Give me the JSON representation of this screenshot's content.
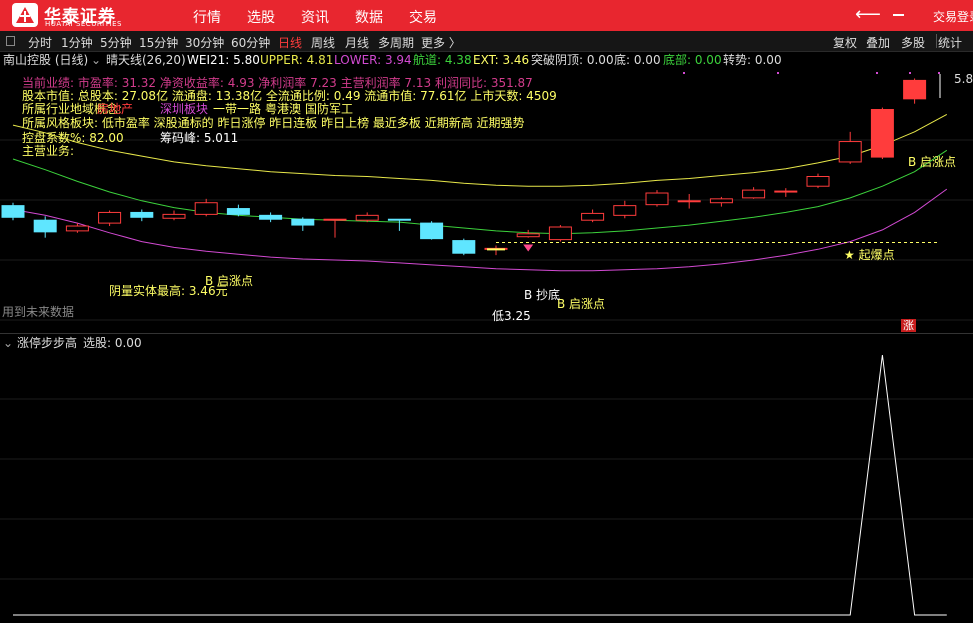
{
  "header": {
    "brand": "华泰证券",
    "brand_en": "HUATAI SECURITIES",
    "nav": [
      "行情",
      "选股",
      "资讯",
      "数据",
      "交易"
    ],
    "back_icon": "arrow-left-icon",
    "trade_login": "交易登录",
    "accent_color": "#e8262f"
  },
  "toolbar": {
    "periods": [
      "分时",
      "1分钟",
      "5分钟",
      "15分钟",
      "30分钟",
      "60分钟",
      "日线",
      "周线",
      "月线",
      "多周期",
      "更多 〉"
    ],
    "active_period": "日线",
    "tools": [
      "复权",
      "叠加",
      "多股",
      "统计"
    ]
  },
  "stock": {
    "title": "南山控股 (日线)",
    "indicator_name": "晴天线(26,20)",
    "wei21": "WEI21: 5.80",
    "upper": "UPPER: 4.81",
    "lower": "LOWER: 3.94",
    "channel": "航道: 4.38",
    "ext": "EXT: 3.46",
    "breakout": "突破阴顶: 0.00",
    "bottom": "底: 0.00",
    "bottom_part": "底部: 0.00",
    "turn": "转势: 0.00"
  },
  "info": {
    "line1": "当前业绩: 市盈率: 31.32 净资收益率: 4.93 净利润率 7.23 主营利润率 7.13 利润同比: 351.87",
    "line2": "股本市值: 总股本: 27.08亿 流通盘: 13.38亿 全流通比例: 0.49 流通市值: 77.61亿 上市天数: 4509",
    "line3_label": "所属行业地域概念:",
    "line3_items": [
      "深圳板块",
      "一带一路",
      "粤港澳",
      "国防军工"
    ],
    "line3_overlap": "房地产",
    "line4": "所属风格板块: 低市盈率 深股通标的 昨日涨停 昨日连板 昨日上榜 最近多板 近期新高 近期强势",
    "line5_left": "控盘系数%: 82.00",
    "line5_right": "筹码峰: 5.011",
    "line6": "主营业务:"
  },
  "chart_data": {
    "type": "candlestick",
    "price_range": [
      3.1,
      5.85
    ],
    "candles": [
      {
        "o": 4.35,
        "c": 4.23,
        "h": 4.38,
        "l": 4.2
      },
      {
        "o": 4.2,
        "c": 4.08,
        "h": 4.24,
        "l": 4.02
      },
      {
        "o": 4.09,
        "c": 4.14,
        "h": 4.17,
        "l": 4.07
      },
      {
        "o": 4.17,
        "c": 4.28,
        "h": 4.3,
        "l": 4.14
      },
      {
        "o": 4.28,
        "c": 4.23,
        "h": 4.31,
        "l": 4.19
      },
      {
        "o": 4.22,
        "c": 4.26,
        "h": 4.3,
        "l": 4.2
      },
      {
        "o": 4.26,
        "c": 4.38,
        "h": 4.42,
        "l": 4.24
      },
      {
        "o": 4.32,
        "c": 4.26,
        "h": 4.36,
        "l": 4.24
      },
      {
        "o": 4.25,
        "c": 4.21,
        "h": 4.28,
        "l": 4.18
      },
      {
        "o": 4.21,
        "c": 4.15,
        "h": 4.23,
        "l": 4.09
      },
      {
        "o": 4.2,
        "c": 4.21,
        "h": 4.21,
        "l": 4.02
      },
      {
        "o": 4.2,
        "c": 4.25,
        "h": 4.28,
        "l": 4.18
      },
      {
        "o": 4.21,
        "c": 4.2,
        "h": 4.21,
        "l": 4.09
      },
      {
        "o": 4.17,
        "c": 4.01,
        "h": 4.19,
        "l": 4.0
      },
      {
        "o": 3.99,
        "c": 3.86,
        "h": 4.01,
        "l": 3.84
      },
      {
        "o": 3.91,
        "c": 3.91,
        "h": 3.94,
        "l": 3.84
      },
      {
        "o": 4.03,
        "c": 4.06,
        "h": 4.1,
        "l": 4.02
      },
      {
        "o": 4.0,
        "c": 4.13,
        "h": 4.15,
        "l": 3.98
      },
      {
        "o": 4.2,
        "c": 4.27,
        "h": 4.31,
        "l": 4.18
      },
      {
        "o": 4.25,
        "c": 4.35,
        "h": 4.4,
        "l": 4.22
      },
      {
        "o": 4.36,
        "c": 4.48,
        "h": 4.51,
        "l": 4.34
      },
      {
        "o": 4.4,
        "c": 4.4,
        "h": 4.47,
        "l": 4.32
      },
      {
        "o": 4.38,
        "c": 4.42,
        "h": 4.44,
        "l": 4.34
      },
      {
        "o": 4.43,
        "c": 4.51,
        "h": 4.54,
        "l": 4.42
      },
      {
        "o": 4.5,
        "c": 4.5,
        "h": 4.53,
        "l": 4.44
      },
      {
        "o": 4.55,
        "c": 4.65,
        "h": 4.68,
        "l": 4.53
      },
      {
        "o": 4.8,
        "c": 5.01,
        "h": 5.11,
        "l": 4.78
      },
      {
        "o": 4.85,
        "c": 5.34,
        "h": 5.36,
        "l": 4.83
      },
      {
        "o": 5.45,
        "c": 5.64,
        "h": 5.66,
        "l": 5.4
      }
    ],
    "upper_line": [
      5.18,
      5.1,
      5.0,
      4.92,
      4.86,
      4.8,
      4.76,
      4.73,
      4.7,
      4.68,
      4.66,
      4.65,
      4.63,
      4.61,
      4.58,
      4.56,
      4.55,
      4.55,
      4.56,
      4.58,
      4.61,
      4.63,
      4.66,
      4.69,
      4.73,
      4.79,
      4.86,
      4.97,
      5.11,
      5.29
    ],
    "channel_line": [
      4.83,
      4.72,
      4.6,
      4.49,
      4.4,
      4.33,
      4.28,
      4.25,
      4.23,
      4.21,
      4.2,
      4.19,
      4.18,
      4.15,
      4.12,
      4.09,
      4.07,
      4.06,
      4.07,
      4.09,
      4.12,
      4.15,
      4.19,
      4.23,
      4.28,
      4.34,
      4.43,
      4.55,
      4.7,
      4.92
    ],
    "lower_line": [
      4.31,
      4.25,
      4.17,
      4.07,
      3.98,
      3.92,
      3.88,
      3.85,
      3.82,
      3.8,
      3.79,
      3.78,
      3.76,
      3.74,
      3.72,
      3.7,
      3.69,
      3.68,
      3.68,
      3.69,
      3.7,
      3.72,
      3.75,
      3.79,
      3.84,
      3.9,
      3.98,
      4.1,
      4.28,
      4.52
    ],
    "ext_level": 3.97,
    "line_colors": {
      "upper": "#e8e84a",
      "channel": "#3cd23c",
      "lower": "#d24ad2",
      "up": "#ff3c3c",
      "down": "#5fe6ff",
      "ext": "#ffff66"
    },
    "annotations": {
      "yin_high": "阴量实体最高: 3.46元",
      "start_1": "B 启涨点",
      "start_2": "B 启涨点",
      "start_3": "B 启涨点",
      "bottom_pick": "B 抄底",
      "low_price": "低3.25",
      "explode": "★ 起爆点",
      "future_data": "用到未来数据",
      "price_max": "5.8",
      "limit_badge": "涨"
    },
    "sub_indicator": {
      "title": "涨停步步高",
      "value": "选股: 0.00",
      "values": [
        0,
        0,
        0,
        0,
        0,
        0,
        0,
        0,
        0,
        0,
        0,
        0,
        0,
        0,
        0,
        0,
        0,
        0,
        0,
        0,
        0,
        0,
        0,
        0,
        0,
        0,
        0,
        1,
        0,
        0
      ]
    }
  }
}
